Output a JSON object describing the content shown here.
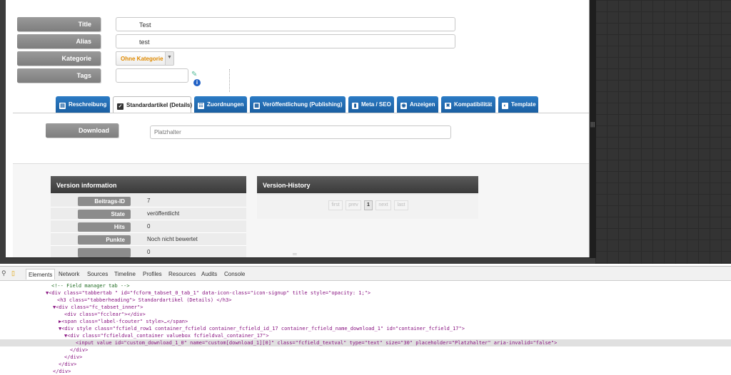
{
  "form": {
    "title_label": "Title",
    "title_value": "Test",
    "alias_label": "Alias",
    "alias_value": "test",
    "category_label": "Kategorie",
    "category_value": "Ohne Kategorie",
    "tags_label": "Tags"
  },
  "tabs": [
    {
      "label": "Reschreibung",
      "icon": "document-icon"
    },
    {
      "label": "Standardartikel (Details)",
      "icon": "clipboard-icon"
    },
    {
      "label": "Zuordnungen",
      "icon": "sitemap-icon"
    },
    {
      "label": "Veröffentlichung (Publishing)",
      "icon": "calendar-icon"
    },
    {
      "label": "Meta / SEO",
      "icon": "bookmark-icon"
    },
    {
      "label": "Anzeigen",
      "icon": "eye-icon"
    },
    {
      "label": "Kompatibilität",
      "icon": "puzzle-icon"
    },
    {
      "label": "Template",
      "icon": "palette-icon"
    }
  ],
  "download": {
    "label": "Download",
    "placeholder": "Platzhalter"
  },
  "version_info": {
    "title": "Version information",
    "rows": [
      {
        "key": "Beitrags-ID",
        "value": "7"
      },
      {
        "key": "State",
        "value": "veröffentlicht"
      },
      {
        "key": "Hits",
        "value": "0"
      },
      {
        "key": "Punkte",
        "value": "Noch nicht bewertet"
      },
      {
        "key": "",
        "value": "0"
      }
    ]
  },
  "version_history": {
    "title": "Version-History",
    "pager": [
      "first",
      "prev",
      "1",
      "next",
      "last"
    ]
  },
  "devtools": {
    "tabs": [
      "Elements",
      "Network",
      "Sources",
      "Timeline",
      "Profiles",
      "Resources",
      "Audits",
      "Console"
    ],
    "lines": [
      "<!-- Field manager tab -->",
      "▼<div class=\"tabbertab \" id=\"fcform_tabset_0_tab_1\" data-icon-class=\"icon-signup\" title style=\"opacity: 1;\">",
      "<h3 class=\"tabberheading\"> Standardartikel (Details) </h3>",
      "▼<div class=\"fc_tabset_inner\">",
      "<div class=\"fcclear\"></div>",
      "▶<span class=\"label-fcouter\" style>…</span>",
      "▼<div style class=\"fcfield_row1 container_fcfield container_fcfield_id_17 container_fcfield_name_download_1\" id=\"container_fcfield_17\">",
      "▼<div class=\"fcfieldval_container valuebox fcfieldval_container_17\">",
      "<input value id=\"custom_download_1_0\" name=\"custom[download_1][0]\" class=\"fcfield_textval\" type=\"text\" size=\"30\" placeholder=\"Platzhalter\" aria-invalid=\"false\">",
      "</div>",
      "</div>",
      "</div>",
      "</div>"
    ]
  }
}
